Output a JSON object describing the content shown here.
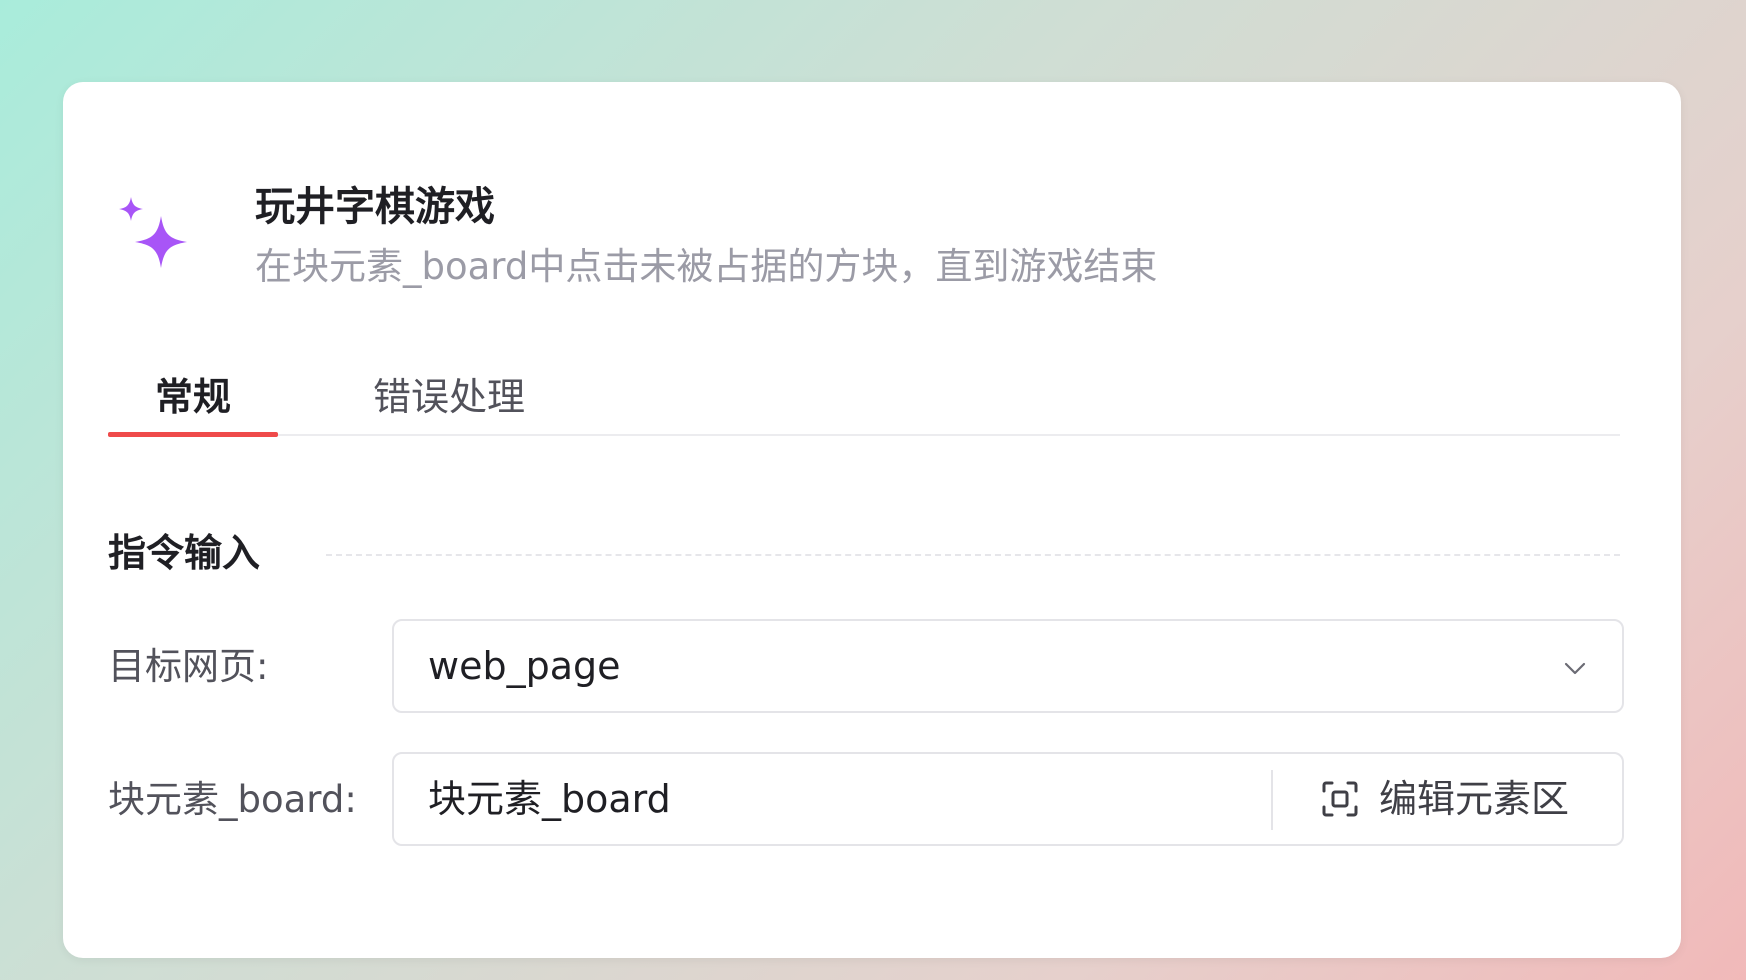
{
  "header": {
    "title": "玩井字棋游戏",
    "subtitle": "在块元素_board中点击未被占据的方块，直到游戏结束",
    "icon": "sparkle-icon",
    "icon_color": "#a855f7"
  },
  "tabs": [
    {
      "label": "常规",
      "active": true
    },
    {
      "label": "错误处理",
      "active": false
    }
  ],
  "accent_color": "#ef4a4a",
  "section": {
    "title": "指令输入"
  },
  "fields": {
    "target_webpage": {
      "label": "目标网页:",
      "value": "web_page"
    },
    "board_element": {
      "label": "块元素_board:",
      "value": "块元素_board",
      "edit_label": "编辑元素区",
      "edit_icon": "scan-target-icon"
    }
  }
}
